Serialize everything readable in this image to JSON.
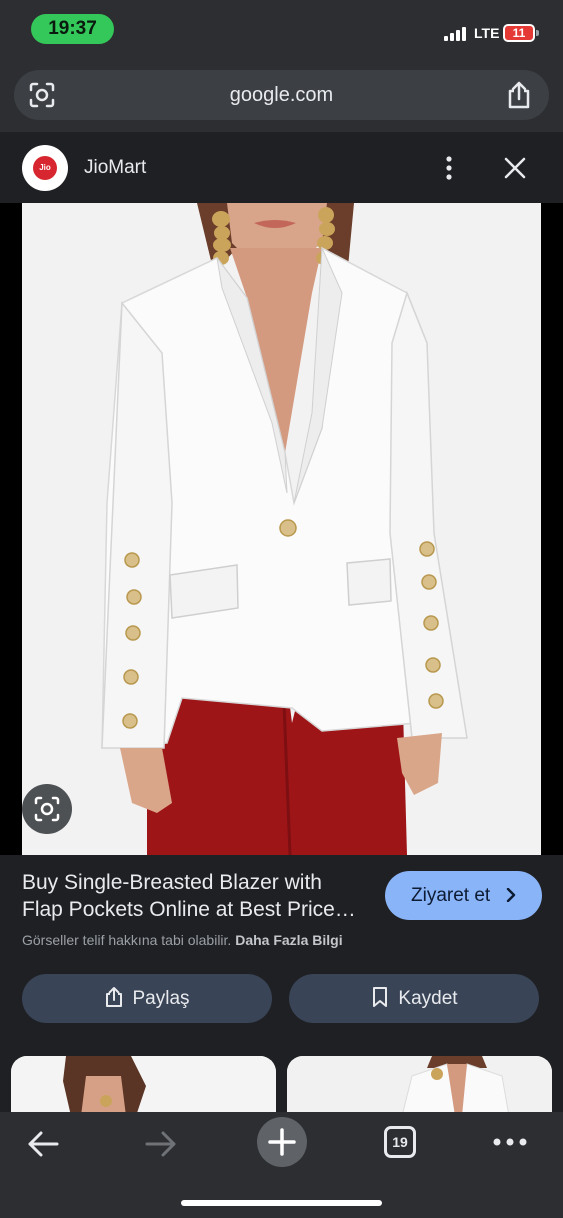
{
  "status_bar": {
    "time": "19:37",
    "network": "LTE",
    "battery": "11"
  },
  "address_bar": {
    "url": "google.com",
    "lens_icon": "google-lens-icon",
    "share_icon": "share-icon"
  },
  "source": {
    "logo_text": "Jio",
    "name": "JioMart",
    "more_icon": "more-vertical-icon",
    "close_icon": "close-icon"
  },
  "image": {
    "lens_icon": "visual-search-icon"
  },
  "product": {
    "title_line1": "Buy Single-Breasted Blazer with",
    "title_line2": "Flap Pockets Online at Best Price…",
    "visit_label": "Ziyaret et",
    "copyright_text": "Görseller telif hakkına tabi olabilir.",
    "more_info_label": "Daha Fazla Bilgi"
  },
  "actions": {
    "share_label": "Paylaş",
    "save_label": "Kaydet"
  },
  "toolbar": {
    "tab_count": "19"
  },
  "colors": {
    "accent_blue": "#8ab4f8",
    "action_button": "#394457",
    "status_green": "#34c759",
    "battery_red": "#e53935",
    "background": "#1f2023"
  }
}
